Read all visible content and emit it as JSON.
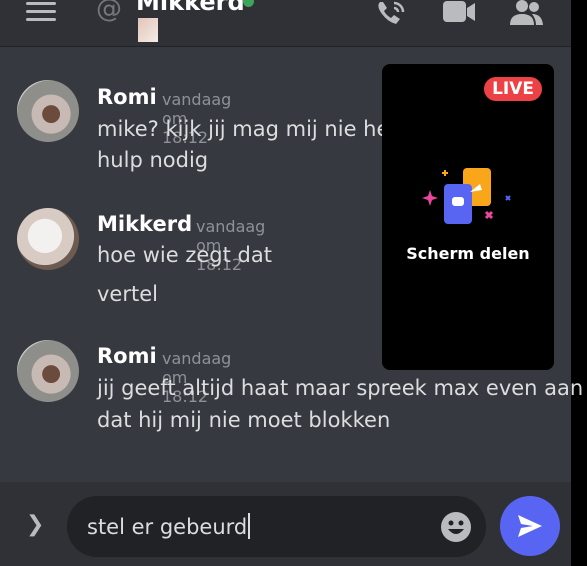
{
  "header": {
    "channel_name": "Mikkerd",
    "at_symbol": "@"
  },
  "messages": [
    {
      "author": "Romi",
      "timestamp": "vandaag om 18:12",
      "lines": [
        "mike? kijk jij mag mij nie he r",
        "hulp nodig"
      ]
    },
    {
      "author": "Mikkerd",
      "timestamp": "vandaag om 18:12",
      "lines": [
        "hoe wie zegt dat",
        "vertel"
      ]
    },
    {
      "author": "Romi",
      "timestamp": "vandaag om 18:12",
      "lines": [
        "jij geeft altijd haat maar spreek max even aan",
        "dat hij mij nie moet blokken"
      ]
    }
  ],
  "live_card": {
    "badge": "LIVE",
    "label": "Scherm delen"
  },
  "composer": {
    "value": "stel er gebeurd"
  },
  "colors": {
    "accent": "#5865f2",
    "live": "#ed4245",
    "online": "#3ba55c"
  },
  "icons": [
    "menu-icon",
    "at-icon",
    "phone-call-icon",
    "video-call-icon",
    "members-icon",
    "chevron-right-icon",
    "emoji-icon",
    "send-icon"
  ]
}
